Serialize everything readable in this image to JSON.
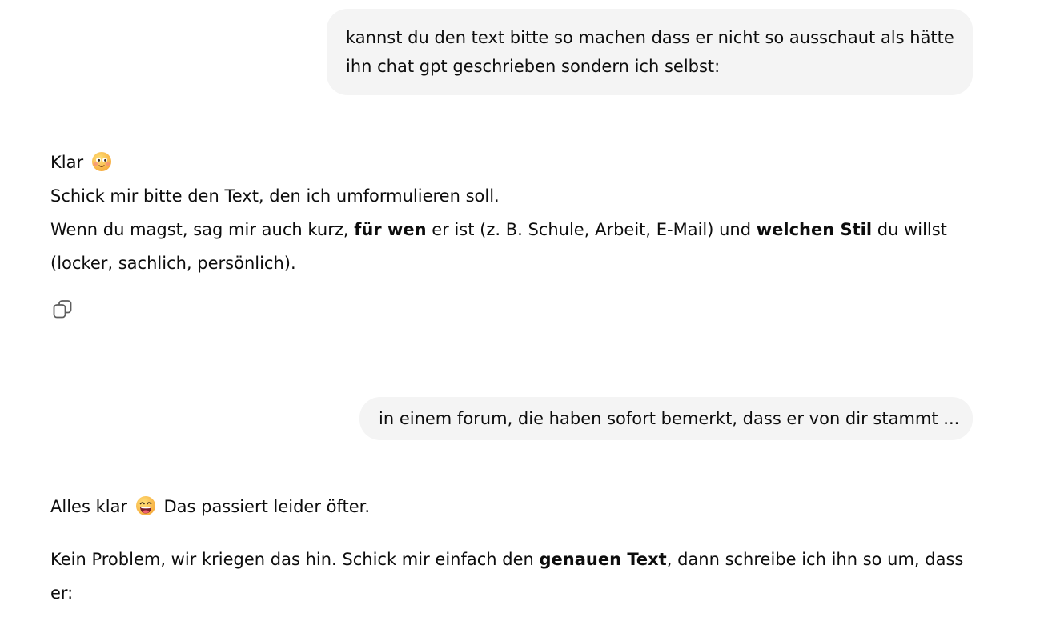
{
  "conversation": {
    "user_message_1": {
      "line_1": "kannst du den text bitte so machen dass er nicht so ausschaut als hätte",
      "line_2": "ihn chat gpt geschrieben sondern ich selbst:"
    },
    "assistant_message_1": {
      "line_1_text": "Klar",
      "line_1_emoji": "slightly-smiling-face-emoji",
      "line_2": "Schick mir bitte den Text, den ich umformulieren soll.",
      "line_3_part_1": "Wenn du magst, sag mir auch kurz, ",
      "line_3_bold_1": "für wen",
      "line_3_part_2": " er ist (z. B. Schule, Arbeit, E-Mail) und ",
      "line_3_bold_2": "welchen Stil",
      "line_3_part_3": " du willst",
      "line_4": "(locker, sachlich, persönlich).",
      "copy_icon": "copy-icon"
    },
    "user_message_2": {
      "text": "in einem forum, die haben sofort bemerkt, dass er von dir stammt ..."
    },
    "assistant_message_2": {
      "line_1_part_1": "Alles klar",
      "line_1_emoji": "grinning-face-emoji",
      "line_1_part_2": "Das passiert leider öfter.",
      "para_2_part_1": "Kein Problem, wir kriegen das hin. Schick mir einfach den ",
      "para_2_bold": "genauen Text",
      "para_2_part_2": ", dann schreibe ich ihn so um, dass",
      "para_2_line_2": "er:"
    }
  },
  "colors": {
    "user_bubble_bg": "#f4f4f4",
    "text": "#0d0d0d",
    "icon": "#5d5d5d"
  }
}
